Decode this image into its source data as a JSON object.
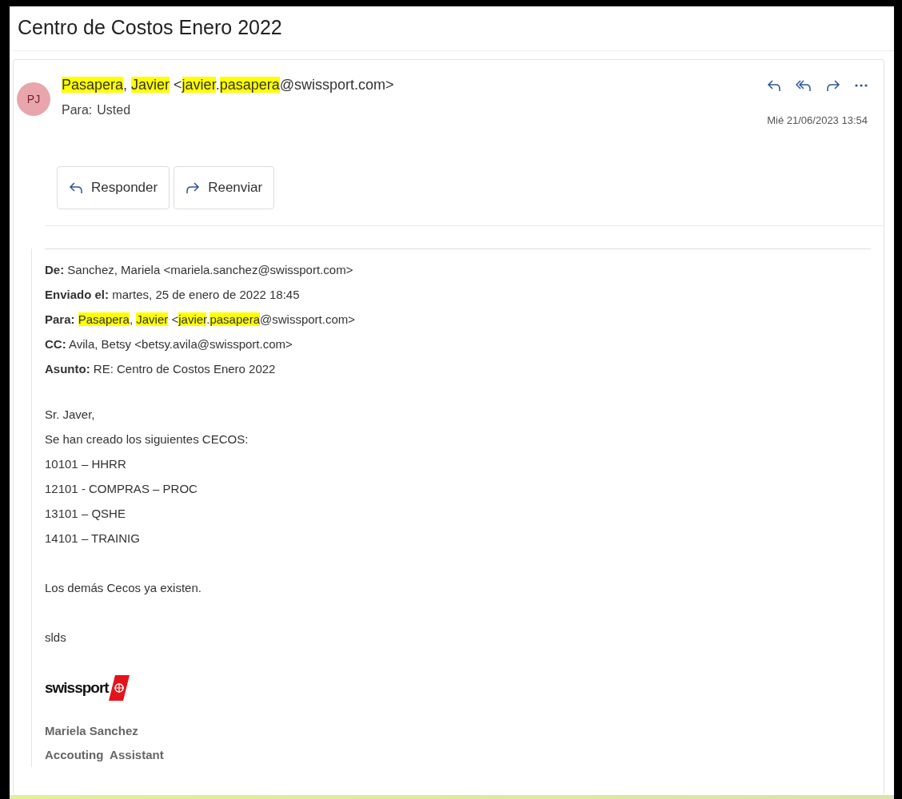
{
  "subject": "Centro de Costos Enero 2022",
  "message": {
    "avatar": "PJ",
    "sender": [
      {
        "text": "Pasapera",
        "highlighted": true
      },
      {
        "text": ", ",
        "highlighted": false
      },
      {
        "text": "Javier",
        "highlighted": true
      },
      {
        "text": " <",
        "highlighted": false
      },
      {
        "text": "javier",
        "highlighted": true
      },
      {
        "text": ".",
        "highlighted": false
      },
      {
        "text": "pasapera",
        "highlighted": true
      },
      {
        "text": "@swissport.com>",
        "highlighted": false
      }
    ],
    "to_label": "Para:",
    "to": "Usted",
    "date": "Mié 21/06/2023 13:54",
    "actions": [
      {
        "kind": "reply",
        "label": "Responder"
      },
      {
        "kind": "forward",
        "label": "Reenviar"
      }
    ]
  },
  "quoted": {
    "headers": [
      {
        "label": "De:",
        "value": [
          {
            "text": "Sanchez, Mariela <mariela.sanchez@swissport.com>",
            "highlighted": false
          }
        ]
      },
      {
        "label": "Enviado el:",
        "value": [
          {
            "text": "martes, 25 de enero de 2022 18:45",
            "highlighted": false
          }
        ]
      },
      {
        "label": "Para:",
        "value": [
          {
            "text": "Pasapera",
            "highlighted": true
          },
          {
            "text": ", ",
            "highlighted": false
          },
          {
            "text": "Javier",
            "highlighted": true
          },
          {
            "text": " <",
            "highlighted": false
          },
          {
            "text": "javier",
            "highlighted": true
          },
          {
            "text": ".",
            "highlighted": false
          },
          {
            "text": "pasapera",
            "highlighted": true
          },
          {
            "text": "@swissport.com>",
            "highlighted": false
          }
        ]
      },
      {
        "label": "CC:",
        "value": [
          {
            "text": "Avila, Betsy <betsy.avila@swissport.com>",
            "highlighted": false
          }
        ]
      },
      {
        "label": "Asunto:",
        "value": [
          {
            "text": "RE: Centro de Costos Enero 2022",
            "highlighted": false
          }
        ]
      }
    ],
    "paragraphs": [
      [
        "Sr. Javer,",
        "Se han creado los siguientes CECOS:",
        "10101 – HHRR",
        "12101 - COMPRAS – PROC",
        "13101 – QSHE",
        "14101 – TRAINIG"
      ],
      [
        "Los demás Cecos ya existen."
      ],
      [
        "slds"
      ]
    ],
    "signature": {
      "logo": "swissport",
      "name": "Mariela Sanchez",
      "title": "Accouting  Assistant"
    }
  }
}
